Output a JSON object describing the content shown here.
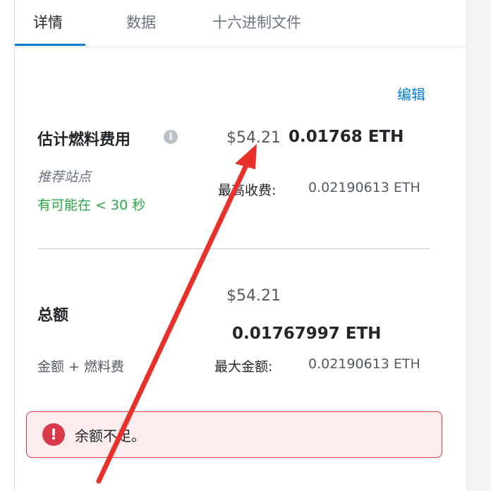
{
  "tabs": [
    {
      "label": "详情"
    },
    {
      "label": "数据"
    },
    {
      "label": "十六进制文件"
    }
  ],
  "edit_label": "编辑",
  "gas": {
    "title": "估计燃料费用",
    "info_glyph": "i",
    "usd": "$54.21",
    "eth": "0.01768 ETH",
    "site_suggested": "推荐站点",
    "eta": "有可能在 < 30 秒",
    "max_fee_label": "最高收费:",
    "max_fee_value": "0.02190613 ETH"
  },
  "total": {
    "title": "总额",
    "usd": "$54.21",
    "eth": "0.01767997 ETH",
    "subtitle": "金额 + 燃料费",
    "max_amount_label": "最大金额:",
    "max_amount_value": "0.02190613 ETH"
  },
  "alert": {
    "icon_glyph": "!",
    "text": "余额不足。"
  },
  "colors": {
    "accent": "#037dd6",
    "success": "#28a745",
    "error": "#d73a49",
    "error_bg": "#fbeced",
    "annotation_arrow": "#e8312b"
  },
  "icons": {
    "info": "info-icon",
    "alert": "exclamation-icon",
    "annotation": "red-arrow"
  }
}
